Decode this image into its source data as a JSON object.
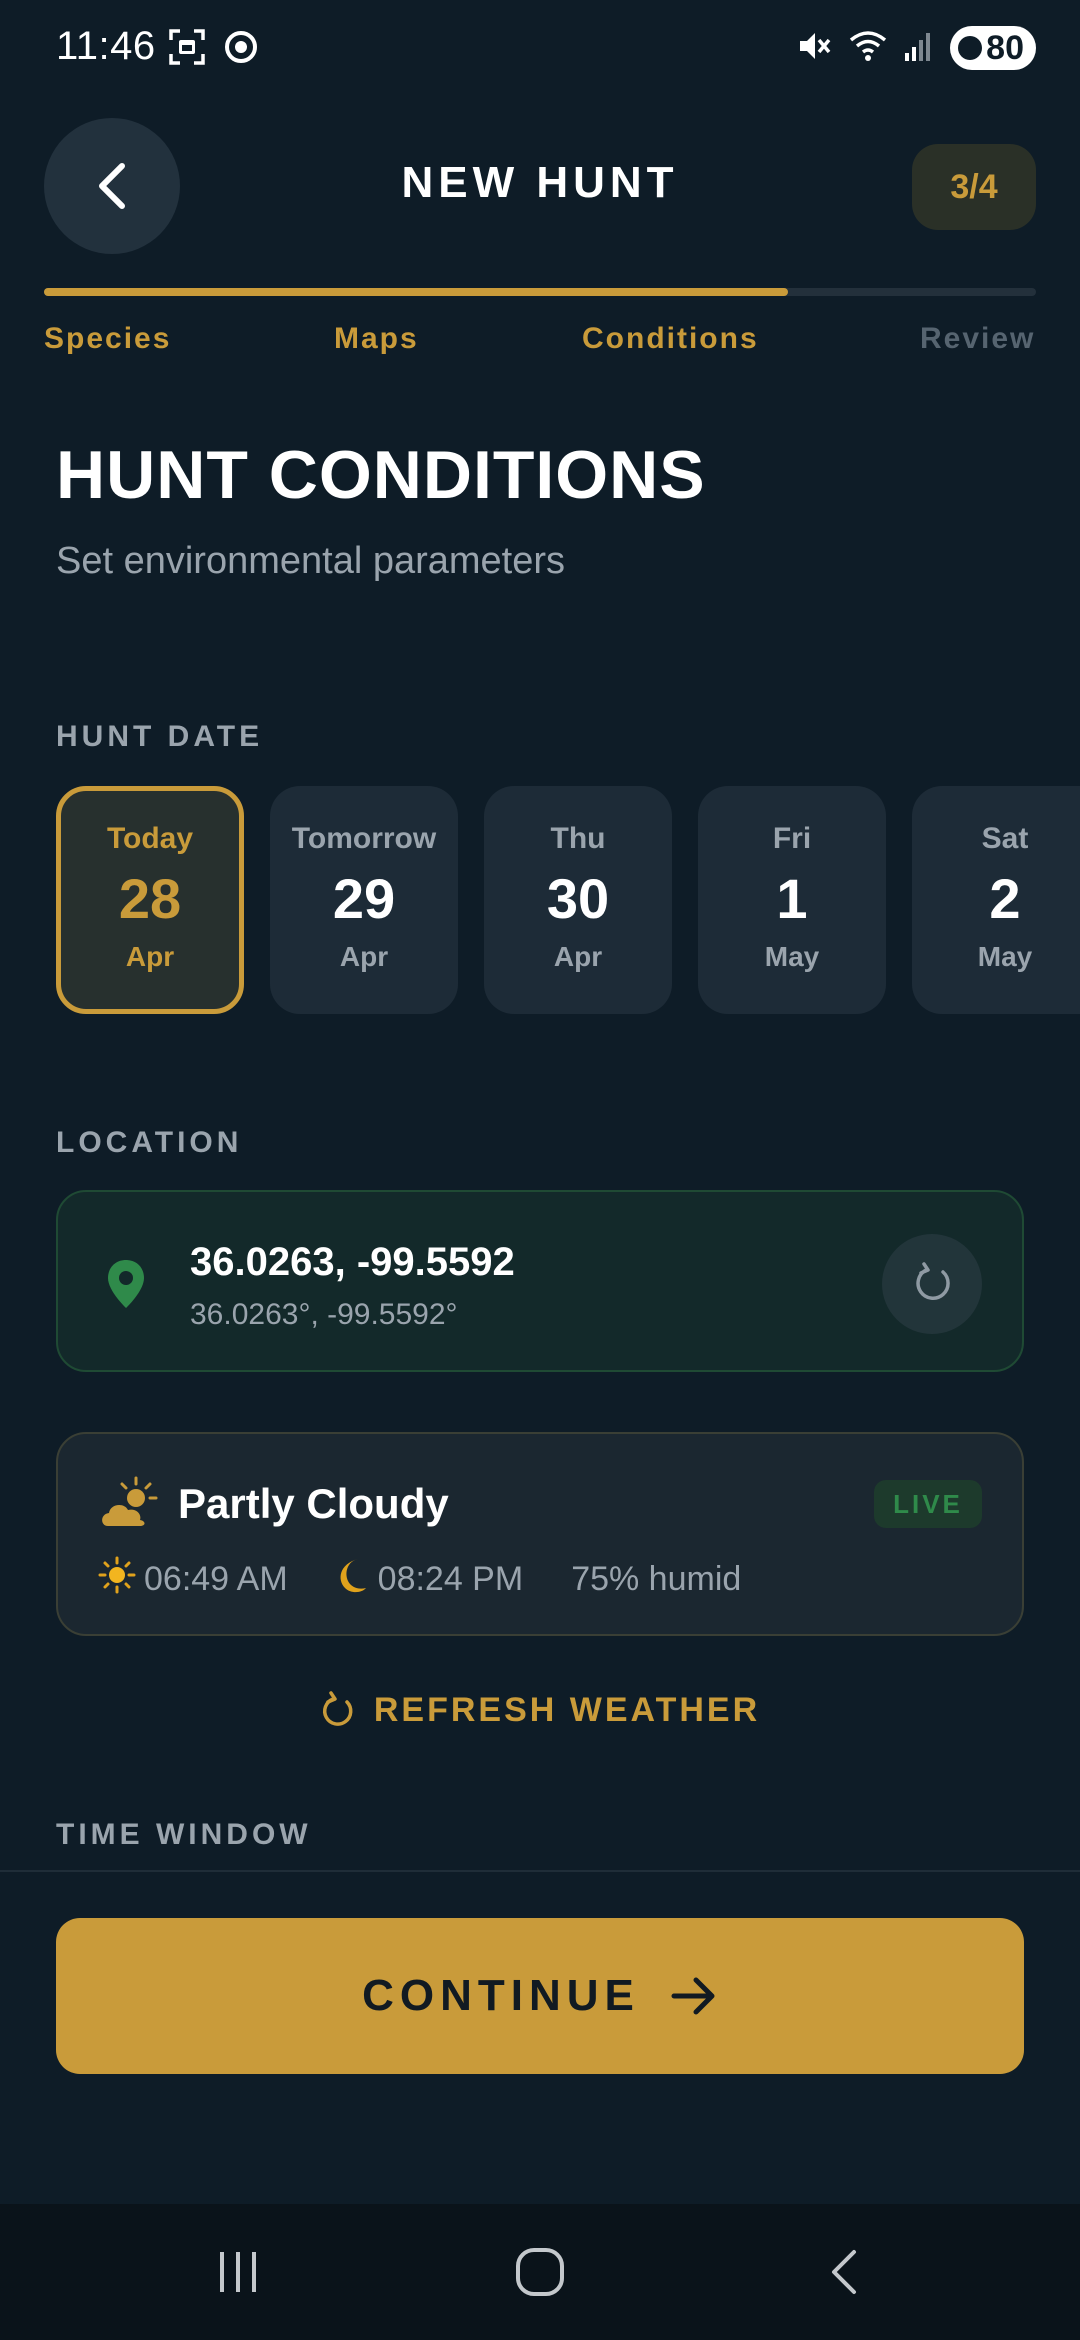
{
  "status_bar": {
    "time": "11:46",
    "battery": "80"
  },
  "header": {
    "title": "NEW HUNT",
    "step_badge": "3/4",
    "progress": 0.75
  },
  "steps": [
    {
      "label": "Species",
      "state": "done"
    },
    {
      "label": "Maps",
      "state": "done"
    },
    {
      "label": "Conditions",
      "state": "active"
    },
    {
      "label": "Review",
      "state": "upcoming"
    }
  ],
  "page": {
    "title": "HUNT CONDITIONS",
    "subtitle": "Set environmental parameters"
  },
  "hunt_date": {
    "section_label": "HUNT DATE",
    "dates": [
      {
        "day": "Today",
        "num": "28",
        "month": "Apr",
        "selected": true
      },
      {
        "day": "Tomorrow",
        "num": "29",
        "month": "Apr",
        "selected": false
      },
      {
        "day": "Thu",
        "num": "30",
        "month": "Apr",
        "selected": false
      },
      {
        "day": "Fri",
        "num": "1",
        "month": "May",
        "selected": false
      },
      {
        "day": "Sat",
        "num": "2",
        "month": "May",
        "selected": false
      }
    ]
  },
  "location": {
    "section_label": "LOCATION",
    "coords": "36.0263, -99.5592",
    "coords_sub": "36.0263°, -99.5592°"
  },
  "weather": {
    "condition": "Partly Cloudy",
    "badge": "LIVE",
    "sunrise": "06:49 AM",
    "sunset": "08:24 PM",
    "humidity": "75% humid",
    "refresh_label": "REFRESH WEATHER"
  },
  "time_window": {
    "section_label": "TIME WINDOW"
  },
  "footer": {
    "continue_label": "CONTINUE"
  },
  "colors": {
    "accent": "#c99b3a",
    "background": "#0e1c27",
    "live": "#2f8a4a",
    "pin": "#2f8a4a"
  }
}
